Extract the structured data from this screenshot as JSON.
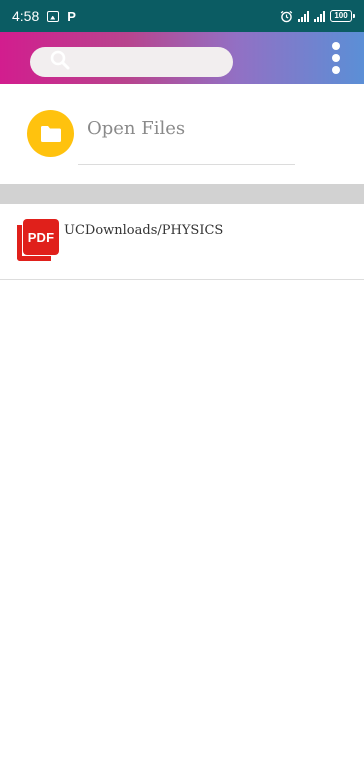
{
  "status_bar": {
    "time": "4:58",
    "notification_letter": "P",
    "battery_level": "100",
    "icons": [
      "gallery-icon",
      "p-app-icon",
      "alarm-icon",
      "signal-icon",
      "signal-icon",
      "battery-icon"
    ]
  },
  "app_bar": {
    "gradient_colors": [
      "#d21d8e",
      "#9270c4",
      "#5b8fd6"
    ],
    "search": {
      "placeholder": "",
      "value": "",
      "icon": "search-icon"
    },
    "menu_icon": "more-vert-icon"
  },
  "open_files": {
    "label": "Open Files",
    "icon": "folder-icon",
    "icon_color": "#ffc20e"
  },
  "files": [
    {
      "path": "UCDownloads/PHYSICS",
      "icon": "pdf-icon",
      "icon_label": "PDF",
      "icon_color": "#e0201b"
    }
  ]
}
